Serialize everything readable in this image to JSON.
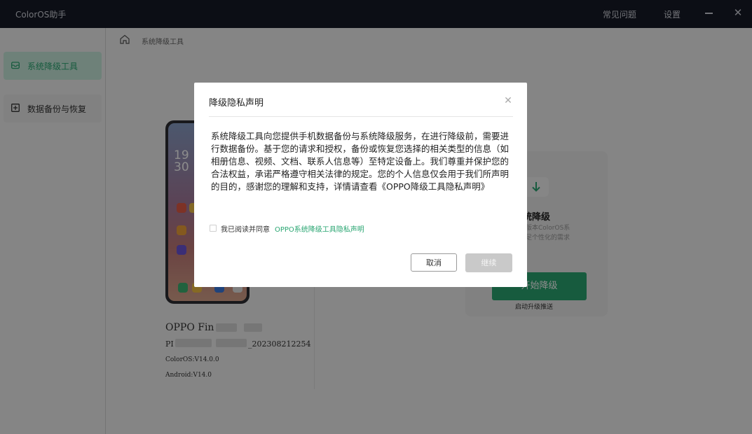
{
  "app": {
    "title": "ColorOS助手",
    "faq_label": "常见问题",
    "settings_label": "设置"
  },
  "sidebar": {
    "items": [
      {
        "label": "系统降级工具",
        "active": true
      },
      {
        "label": "数据备份与恢复",
        "active": false
      }
    ]
  },
  "breadcrumb": {
    "current": "系统降级工具"
  },
  "device": {
    "clock_hour": "19",
    "clock_min": "30",
    "name_prefix": "OPPO Fin",
    "model_prefix": "PI",
    "model_suffix": "_202308212254",
    "coloros_version": "ColorOS:V14.0.0",
    "android_version": "Android:V14.0"
  },
  "downgrade_card": {
    "title": "统降级",
    "desc_line1": "版本ColorOS系",
    "desc_line2": "足个性化的需求",
    "start_button": "开始降级",
    "hint": "启动升级推送"
  },
  "dialog": {
    "title": "降级隐私声明",
    "body": "系统降级工具向您提供手机数据备份与系统降级服务，在进行降级前，需要进行数据备份。基于您的请求和授权，备份或恢复您选择的相关类型的信息（如相册信息、视频、文档、联系人信息等）至特定设备上。我们尊重并保护您的合法权益，承诺严格遵守相关法律的规定。您的个人信息仅会用于我们所声明的目的，感谢您的理解和支持，详情请查看《OPPO降级工具隐私声明》",
    "agree_text": "我已阅读并同意",
    "agree_link": "OPPO系统降级工具隐私声明",
    "cancel_label": "取消",
    "continue_label": "继续"
  },
  "colors": {
    "accent": "#2aa672",
    "titlebar": "#161a27"
  }
}
